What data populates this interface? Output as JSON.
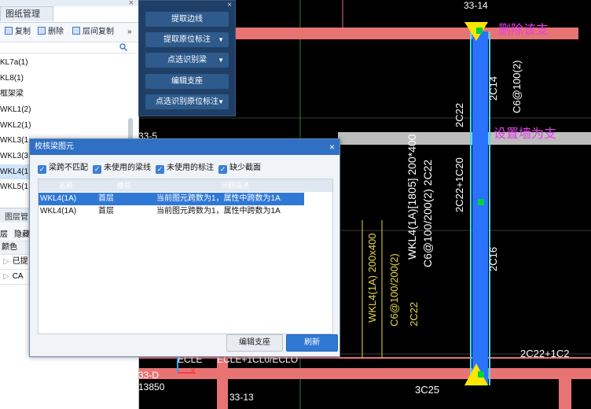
{
  "left_panel": {
    "title": "图纸管理",
    "close_glyph": "×",
    "toolbar": {
      "copy_label": "复制",
      "delete_label": "删除",
      "floor_copy_label": "层间复制",
      "more_glyph": "»"
    },
    "search_icon": "search-icon",
    "items": [
      {
        "label": "KL7a(1)",
        "selected": false
      },
      {
        "label": "KL8(1)",
        "selected": false
      },
      {
        "label": "框架梁",
        "selected": false
      },
      {
        "label": "WKL1(2)",
        "selected": false
      },
      {
        "label": "WKL2(1)",
        "selected": false
      },
      {
        "label": "WKL3(1",
        "selected": false
      },
      {
        "label": "WKL3(3",
        "selected": false
      },
      {
        "label": "WKL4(1",
        "selected": true
      },
      {
        "label": "WKL5(1",
        "selected": false
      }
    ],
    "layer_section": {
      "title": "图层管",
      "tool_a": "层",
      "tool_b": "隐藏",
      "col_header": "颜色",
      "rows": [
        "已提",
        "CA"
      ]
    }
  },
  "cmd_panel": {
    "close_glyph": "×",
    "buttons": [
      {
        "label": "提取边线",
        "has_arrow": false
      },
      {
        "label": "提取原位标注",
        "has_arrow": true
      },
      {
        "label": "点选识别梁",
        "has_arrow": true
      },
      {
        "label": "编辑支座",
        "has_arrow": false
      },
      {
        "label": "点选识别原位标注",
        "has_arrow": true
      }
    ],
    "arrow_glyph": "▼"
  },
  "dialog": {
    "title": "校核梁图元",
    "close_glyph": "×",
    "checks": [
      {
        "label": "梁跨不匹配",
        "checked": true
      },
      {
        "label": "未使用的梁线",
        "checked": true
      },
      {
        "label": "未使用的标注",
        "checked": true
      },
      {
        "label": "缺少截面",
        "checked": true
      }
    ],
    "columns": [
      "名称",
      "楼层",
      "问题描述"
    ],
    "rows": [
      {
        "name": "WKL4(1A)",
        "floor": "首层",
        "desc": "当前图元跨数为1，属性中跨数为1A",
        "selected": true
      },
      {
        "name": "WKL4(1A)",
        "floor": "首层",
        "desc": "当前图元跨数为1，属性中跨数为1A",
        "selected": false
      }
    ],
    "btn_edit": "编辑支座",
    "btn_refresh": "刷新"
  },
  "cad": {
    "grid_label_top": "33-14",
    "callout_delete": "删除该支",
    "callout_set_wall": "设置墙为支",
    "beam_label_main": "WKL4(1A)[1805] 200*400",
    "beam_label_main2": "C6@100/200(2) 2C22",
    "beam_label_yellow": "WKL4(1A) 200x400",
    "beam_label_yellow2": "C6@100/200(2)",
    "beam_label_yellow3": "2C22",
    "rebar_2c22": "2C22",
    "rebar_2c22_1c20": "2C22+1C20",
    "rebar_2c14": "2C14",
    "rebar_c6": "C6@100(2)",
    "rebar_2c16": "2C16",
    "rebar_bottom_right": "2C22+1C2",
    "rebar_bottom_c25": "3C25",
    "grid_label_bottom_left": "33-D",
    "dim_bottom": "13850",
    "grid_label_bottom": "33-13",
    "axis_x": "X",
    "axis_y": "Y",
    "ecle": "ECLE",
    "bottom_rebar": "ECLE+1CL0/ECLO",
    "left_num": "33-5",
    "colors": {
      "beam_red": "#e87373",
      "beam_blue": "#2a73ff",
      "cyan": "#3fe0ff",
      "magenta_text": "#e040e8",
      "yellow": "#e6d84a",
      "yellow_marker": "#ffe600",
      "green_marker": "#00d23c"
    }
  }
}
